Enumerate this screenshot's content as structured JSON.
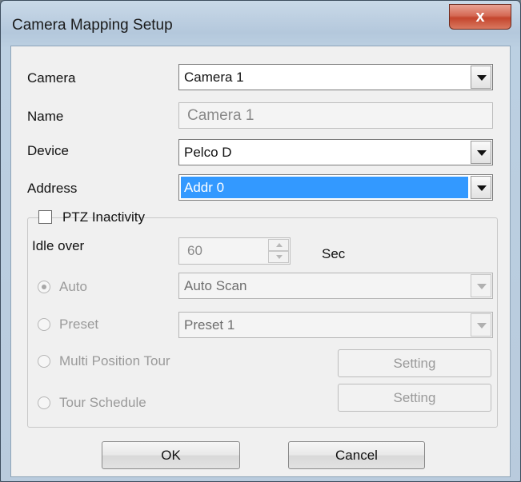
{
  "window": {
    "title": "Camera Mapping Setup",
    "close_glyph": "x"
  },
  "form": {
    "camera": {
      "label": "Camera",
      "value": "Camera 1"
    },
    "name": {
      "label": "Name",
      "value": "Camera 1"
    },
    "device": {
      "label": "Device",
      "value": "Pelco D"
    },
    "address": {
      "label": "Address",
      "value": "Addr 0"
    }
  },
  "ptz": {
    "group_label": "PTZ Inactivity",
    "checked": false,
    "idle_label": "Idle over",
    "idle_value": "60",
    "idle_unit": "Sec",
    "options": {
      "auto": {
        "label": "Auto",
        "value": "Auto Scan",
        "selected": true
      },
      "preset": {
        "label": "Preset",
        "value": "Preset 1"
      },
      "multi_tour": {
        "label": "Multi Position Tour",
        "button": "Setting"
      },
      "tour_schedule": {
        "label": "Tour Schedule",
        "button": "Setting"
      }
    }
  },
  "buttons": {
    "ok": "OK",
    "cancel": "Cancel"
  },
  "colors": {
    "selection": "#3399ff",
    "close_button": "#c4452d"
  }
}
